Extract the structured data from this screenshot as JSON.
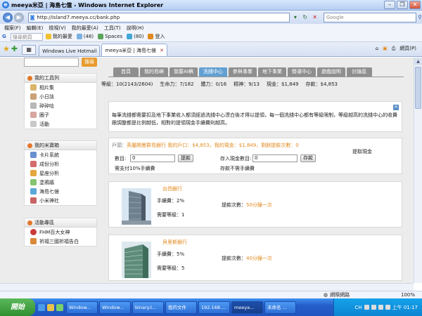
{
  "browser": {
    "title": "meeya米亞 | 海島七億 - Windows Internet Explorer",
    "url": "http://island7.meeya.cc/bank.php",
    "search_placeholder": "Google",
    "menu": [
      "檔案(F)",
      "編輯(E)",
      "檢視(V)",
      "我的最愛(A)",
      "工具(T)",
      "說明(H)"
    ],
    "toolbar_search_placeholder": "搜尋網頁",
    "toolbar_items": [
      "我的最愛",
      "(48)",
      "Spaces",
      "(80)",
      "登入"
    ],
    "tabs": [
      "Windows Live Hotmail",
      "meeya米亞 | 海島七億"
    ],
    "tab_tools": [
      "網頁(P)"
    ]
  },
  "sidebar": {
    "search_button": "搜尋",
    "sections": [
      {
        "title": "我的工具列",
        "items": [
          "相片集",
          "小日誌",
          "碎碎唸",
          "圈子",
          "活動"
        ]
      },
      {
        "title": "我的米寶箱",
        "items": [
          "卡片系統",
          "成份分析",
          "星座分析",
          "塗鴉牆",
          "海島七億",
          "小米神社"
        ]
      },
      {
        "title": "活動專區",
        "items": [
          "FHM百大女神",
          "祈福三國祈福告白"
        ]
      }
    ]
  },
  "main": {
    "nav_tabs": [
      "首頁",
      "我的島嶼",
      "我要AI稿",
      "洗錢中心",
      "參與事業",
      "地下事業",
      "營運中心",
      "遊戲說明",
      "討論區"
    ],
    "active_tab": "洗錢中心",
    "stats": {
      "level": "等級：10(2143/2604)",
      "hp": "生命力：7/182",
      "stamina": "體力：0/16",
      "spirit": "精神：9/13",
      "cash": "現金：$1,849",
      "deposit": "存款：$4,853"
    },
    "notice": "每筆洗錢都需要扣及地下事業收入都須經過洗錢中心漂白後才得以提領，每一個洗錢中心都有等級限制，等級越高的洗錢中心的收費跟調整都是比例越低，相對的提領現金手續費則越高。",
    "account": {
      "line_prefix": "戶頭：",
      "bank": "英屬開曼群島銀行",
      "line_mid": " 我的戶口：$4,853，我的現金：$1,849，剩餘提款次數：",
      "remaining": "0",
      "withdraw_link": "提取現金",
      "withdraw_label": "數目:",
      "withdraw_value": "0",
      "withdraw_button": "提款",
      "withdraw_fee": "需支付10%手續費",
      "deposit_label": "存入現金數目:",
      "deposit_value": "0",
      "deposit_button": "存款",
      "deposit_fee": "存款不需手續費"
    },
    "banks": [
      {
        "name": "台西銀行",
        "fee": "手續費：2%",
        "level": "需要等級：1",
        "withdraw_label": "提款次數：",
        "withdraw_times": "50分鐘一次"
      },
      {
        "name": "貝里斯銀行",
        "fee": "手續費：5%",
        "level": "需要等級：5",
        "withdraw_label": "提款次數：",
        "withdraw_times": "40分鐘一次"
      }
    ]
  },
  "statusbar": {
    "zone": "網際網路",
    "zoom": "100%"
  },
  "taskbar": {
    "start": "開始",
    "tasks": [
      "Window...",
      "Window...",
      "binary.t...",
      "我的文件",
      "192.168....",
      "meeya...",
      "未命名 ..."
    ],
    "lang": "CH",
    "clock": "上午 01:17"
  },
  "colors": {
    "orange": "#e08a1e",
    "tab_active": "#62a0d2",
    "tab_inactive": "#8f8f8f"
  }
}
